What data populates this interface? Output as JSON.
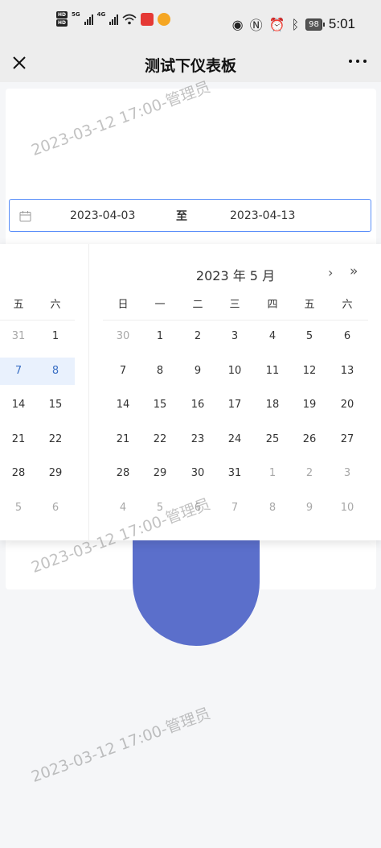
{
  "status_bar": {
    "hd_labels": [
      "HD",
      "HD"
    ],
    "net_labels": [
      "5G",
      "4G"
    ],
    "battery": "98",
    "time": "5:01",
    "icons": [
      "eye-icon",
      "nfc-icon",
      "alarm-icon",
      "bluetooth-icon"
    ]
  },
  "nav": {
    "title": "测试下仪表板"
  },
  "range": {
    "start": "2023-04-03",
    "separator": "至",
    "end": "2023-04-13"
  },
  "left_panel": {
    "weekdays": [
      "五",
      "六"
    ],
    "weeks": [
      [
        "31",
        "1"
      ],
      [
        "7",
        "8"
      ],
      [
        "14",
        "15"
      ],
      [
        "21",
        "22"
      ],
      [
        "28",
        "29"
      ],
      [
        "5",
        "6"
      ]
    ]
  },
  "right_panel": {
    "title": "2023 年 5 月",
    "next": "›",
    "super_next": "»",
    "weekdays": [
      "日",
      "一",
      "二",
      "三",
      "四",
      "五",
      "六"
    ],
    "weeks": [
      [
        "30",
        "1",
        "2",
        "3",
        "4",
        "5",
        "6"
      ],
      [
        "7",
        "8",
        "9",
        "10",
        "11",
        "12",
        "13"
      ],
      [
        "14",
        "15",
        "16",
        "17",
        "18",
        "19",
        "20"
      ],
      [
        "21",
        "22",
        "23",
        "24",
        "25",
        "26",
        "27"
      ],
      [
        "28",
        "29",
        "30",
        "31",
        "1",
        "2",
        "3"
      ],
      [
        "4",
        "5",
        "6",
        "7",
        "8",
        "9",
        "10"
      ]
    ]
  },
  "watermark": "2023-03-12 17:00-管理员",
  "colors": {
    "accent": "#5b8ff9",
    "selected_text": "#3a6fc4",
    "range_bg": "#e9f1fd",
    "chart": "#5b6fcb"
  }
}
